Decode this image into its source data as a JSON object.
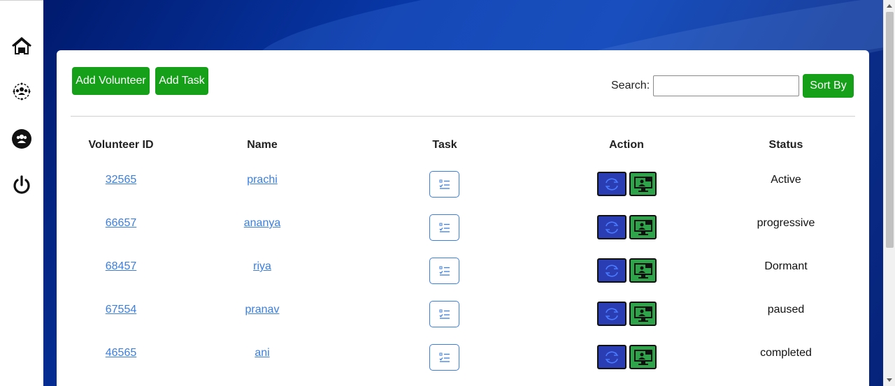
{
  "sidebar": {
    "items": [
      {
        "name": "home",
        "icon": "home-icon"
      },
      {
        "name": "group",
        "icon": "group-network-icon"
      },
      {
        "name": "team",
        "icon": "team-circle-icon"
      },
      {
        "name": "logout",
        "icon": "power-icon"
      }
    ]
  },
  "toolbar": {
    "add_volunteer_label": "Add Volunteer",
    "add_task_label": "Add Task",
    "search_label": "Search:",
    "search_value": "",
    "sort_label": "Sort By"
  },
  "table": {
    "headers": {
      "id": "Volunteer ID",
      "name": "Name",
      "task": "Task",
      "action": "Action",
      "status": "Status"
    },
    "rows": [
      {
        "id": "32565",
        "name": "prachi",
        "status": "Active"
      },
      {
        "id": "66657",
        "name": "ananya",
        "status": "progressive"
      },
      {
        "id": "68457",
        "name": "riya",
        "status": "Dormant"
      },
      {
        "id": "67554",
        "name": "pranav",
        "status": "paused"
      },
      {
        "id": "46565",
        "name": "ani",
        "status": "completed"
      }
    ]
  },
  "colors": {
    "accent_green": "#16a01a",
    "link_blue": "#3b7ee0",
    "action_blue": "#2b3db2",
    "action_green": "#2fa34a"
  }
}
